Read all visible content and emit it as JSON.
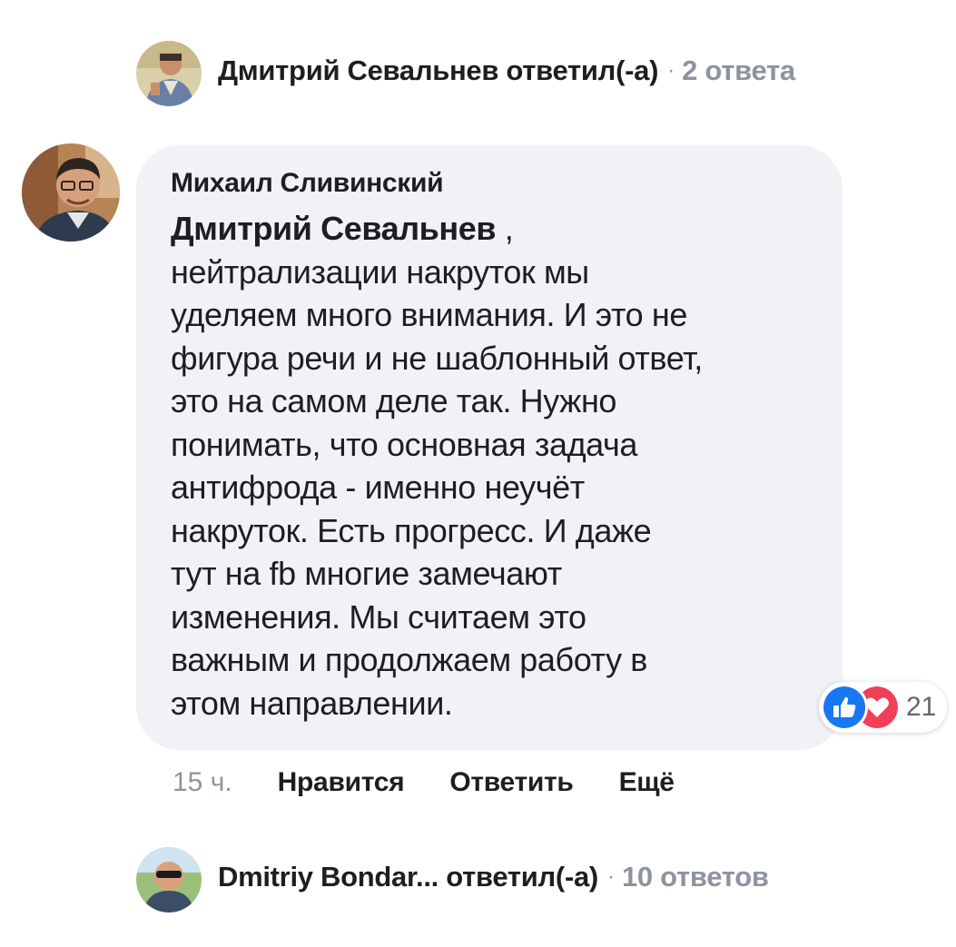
{
  "top_reply": {
    "text": "Дмитрий Севальнев ответил(-а)",
    "separator": "·",
    "count": "2 ответа"
  },
  "comment": {
    "author": "Михаил Сливинский",
    "mention": "Дмитрий Севальнев",
    "mention_suffix": " ,",
    "body_lines": [
      "нейтрализации накруток мы",
      "уделяем много внимания. И это не",
      "фигура речи и не шаблонный ответ,",
      "это на самом деле так. Нужно",
      "понимать, что основная задача",
      "антифрода - именно неучёт",
      "накруток. Есть прогресс. И даже",
      "тут на fb многие замечают",
      "изменения. Мы считаем это",
      "важным и продолжаем работу в",
      "этом направлении."
    ],
    "reactions": {
      "icons": [
        "like-icon",
        "love-icon"
      ],
      "count": "21",
      "like_color": "#1877f2",
      "love_color": "#f33e58"
    }
  },
  "actions": {
    "time": "15 ч.",
    "like": "Нравится",
    "reply": "Ответить",
    "more": "Ещё"
  },
  "bottom_reply": {
    "text": "Dmitriy Bondar... ответил(-а)",
    "separator": "·",
    "count": "10 ответов"
  }
}
